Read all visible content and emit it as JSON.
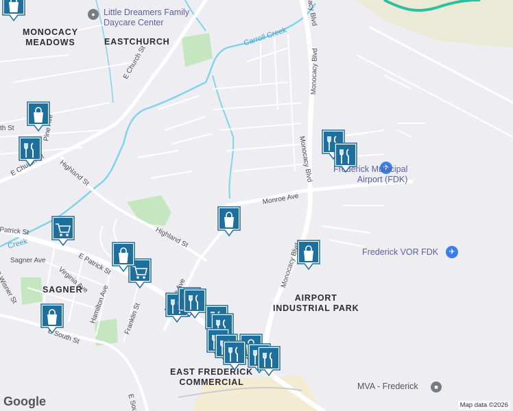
{
  "areas": {
    "monocacy_meadows_1": "MONOCACY",
    "monocacy_meadows_2": "MEADOWS",
    "eastchurch": "EASTCHURCH",
    "sagner": "SAGNER",
    "airport_industrial_1": "AIRPORT",
    "airport_industrial_2": "INDUSTRIAL PARK",
    "east_frederick_1": "EAST FREDERICK",
    "east_frederick_2": "COMMERCIAL"
  },
  "streets": {
    "e_church": "E Church St",
    "e_church_2": "E Church St",
    "highland": "Highland St",
    "highland_2": "Highland St",
    "monroe": "Monroe Ave",
    "monroe_ave_2": "Monroe Ave",
    "monocacy_blvd_1": "Monocacy Blvd",
    "monocacy_blvd_2": "Monocacy Blvd",
    "monocacy_blvd_3": "Monocacy Blvd",
    "monocacy_blvd_top": "Monocacy Blvd",
    "e_patrick": "E Patrick St",
    "patrick_left": "Patrick St",
    "sagner_ave": "Sagner Ave",
    "virginia": "Virginia Ave",
    "hamilton": "Hamilton Ave",
    "franklin": "Franklin St",
    "e_south": "E South St",
    "e_south_2": "E South",
    "s_wisner": "S Wisner St",
    "pine": "Pine Ave",
    "fifth": "th St"
  },
  "water": {
    "carroll_creek": "Carroll Creek",
    "carroll_creek_2": "Creek"
  },
  "pois": {
    "daycare_1": "Little Dreamers Family",
    "daycare_2": "Daycare Center",
    "airport_1": "Frederick Municipal",
    "airport_2": "Airport (FDK)",
    "vor": "Frederick VOR FDK",
    "mva": "MVA - Frederick"
  },
  "logo": "Google",
  "attribution": "Map data ©2026",
  "colors": {
    "pin": "#1f6f9c",
    "road": "#ffffff",
    "creek": "#7fd3ea",
    "park": "#c4e7bf",
    "poi_text": "#5b5f9e"
  },
  "markers": [
    {
      "icon": "shopping-bag-icon"
    },
    {
      "icon": "shopping-bag-icon"
    },
    {
      "icon": "restaurant-icon"
    },
    {
      "icon": "restaurant-icon"
    },
    {
      "icon": "restaurant-icon"
    },
    {
      "icon": "restaurant-icon"
    },
    {
      "icon": "shopping-cart-icon"
    },
    {
      "icon": "shopping-cart-icon"
    },
    {
      "icon": "shopping-bag-icon"
    },
    {
      "icon": "shopping-bag-icon"
    },
    {
      "icon": "shopping-bag-icon"
    },
    {
      "icon": "shopping-bag-icon"
    },
    {
      "icon": "restaurant-icon"
    },
    {
      "icon": "restaurant-icon"
    },
    {
      "icon": "restaurant-icon"
    },
    {
      "icon": "restaurant-icon"
    },
    {
      "icon": "restaurant-icon"
    },
    {
      "icon": "restaurant-icon"
    },
    {
      "icon": "shopping-bag-icon"
    },
    {
      "icon": "restaurant-icon"
    },
    {
      "icon": "restaurant-icon"
    },
    {
      "icon": "restaurant-icon"
    }
  ]
}
